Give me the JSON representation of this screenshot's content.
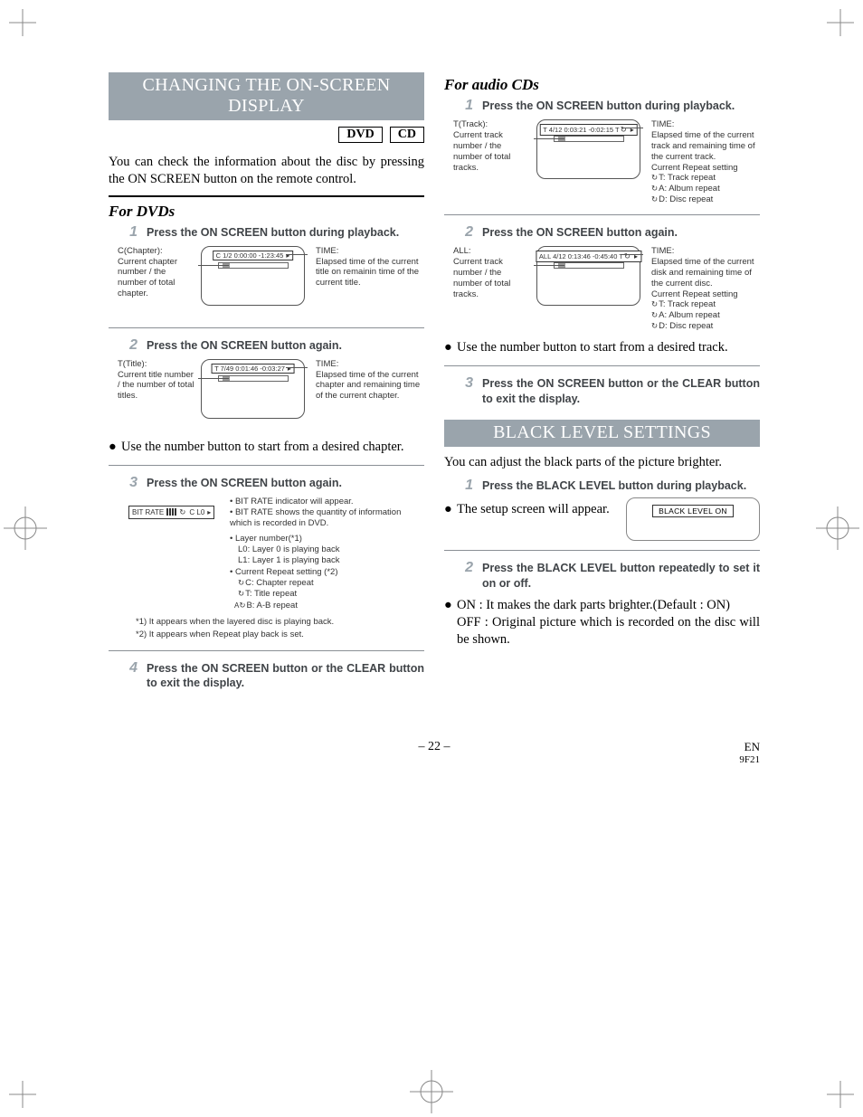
{
  "left": {
    "banner": "CHANGING THE ON-SCREEN DISPLAY",
    "tags": [
      "DVD",
      "CD"
    ],
    "intro": "You can check the information about the disc by pressing the ON SCREEN button on the remote control.",
    "sub1": "For DVDs",
    "step1_num": "1",
    "step1_text": "Press the ON SCREEN button during playback.",
    "fig1": {
      "left_title": "C(Chapter):",
      "left_desc": "Current chapter number / the number of total chapter.",
      "right_title": "TIME:",
      "right_desc": "Elapsed time of the current title on remainin time of the current title.",
      "osd": "C    1/2    0:00:00 -1:23:45"
    },
    "step2_num": "2",
    "step2_text": "Press the ON SCREEN button again.",
    "fig2": {
      "left_title": "T(Title):",
      "left_desc": "Current title number / the number of total titles.",
      "right_title": "TIME:",
      "right_desc": "Elapsed time of the current chapter and remaining time of the current chapter.",
      "osd": "T   7/49   0:01:46 -0:03:27"
    },
    "bullet1": "Use the number button to start from a desired chapter.",
    "step3_num": "3",
    "step3_text": "Press the ON SCREEN button again.",
    "fig3": {
      "bitrate_label": "BIT RATE",
      "bitrate_suffix": "C L0",
      "line1": "• BIT RATE indicator will appear.",
      "line2": "• BIT RATE shows the quantity of information which is recorded in DVD.",
      "line3": "• Layer number(*1)",
      "l0": "L0: Layer 0 is playing back",
      "l1": "L1: Layer 1 is playing back",
      "line4": "• Current Repeat setting (*2)",
      "rc": "C: Chapter repeat",
      "rt": "T: Title repeat",
      "rb": "B: A-B repeat",
      "foot1": "*1) It appears when the layered disc is playing back.",
      "foot2": "*2) It appears when Repeat play back is set."
    },
    "step4_num": "4",
    "step4_text": "Press the ON SCREEN button or the CLEAR button to exit the display."
  },
  "right": {
    "sub1": "For audio CDs",
    "step1_num": "1",
    "step1_text": "Press the ON SCREEN button during playback.",
    "fig1": {
      "left_title": "T(Track):",
      "left_desc": "Current track number / the number of total tracks.",
      "right_title": "TIME:",
      "right_desc": "Elapsed time of the current track and remaining time of the current track.",
      "right_extra": "Current Repeat setting",
      "r1": "T: Track repeat",
      "r2": "A: Album repeat",
      "r3": "D: Disc repeat",
      "osd": "T  4/12  0:03:21 -0:02:15  T"
    },
    "step2_num": "2",
    "step2_text": "Press the ON SCREEN button again.",
    "fig2": {
      "left_title": "ALL:",
      "left_desc": "Current track number / the number of total tracks.",
      "right_title": "TIME:",
      "right_desc": "Elapsed time of the current disk and remaining time of the current disc.",
      "right_extra": "Current Repeat setting",
      "r1": "T: Track repeat",
      "r2": "A: Album repeat",
      "r3": "D: Disc repeat",
      "osd": "ALL 4/12  0:13:46 -0:45:40  T"
    },
    "bullet1": "Use the number button to start from a desired track.",
    "step3_num": "3",
    "step3_text": "Press the ON SCREEN button or the CLEAR button to exit the display.",
    "banner2": "BLACK LEVEL SETTINGS",
    "bl_intro": "You can adjust the black parts of the picture brighter.",
    "bl_step1_num": "1",
    "bl_step1_text": "Press the BLACK LEVEL button during playback.",
    "bl_bullet1": "The setup screen will appear.",
    "bl_box": "BLACK LEVEL      ON",
    "bl_step2_num": "2",
    "bl_step2_text": "Press the BLACK LEVEL button repeatedly to set it on or off.",
    "bl_bullet2a": "ON : It makes the dark parts brighter.(Default : ON)",
    "bl_bullet2b": "OFF : Original picture which is recorded on the disc will be shown."
  },
  "footer": {
    "page": "– 22 –",
    "lang": "EN",
    "code": "9F21"
  }
}
